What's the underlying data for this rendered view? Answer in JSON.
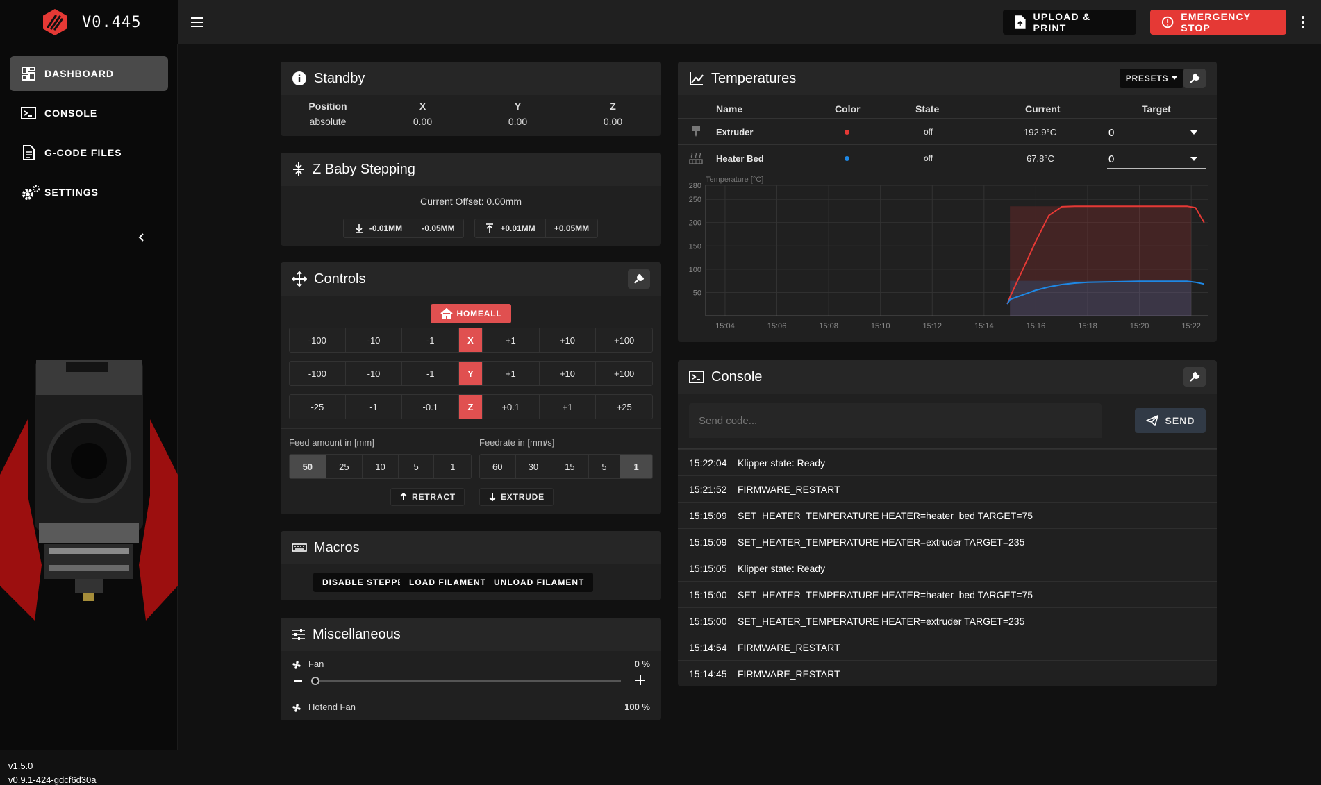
{
  "app": {
    "title": "V0.445"
  },
  "topbar": {
    "upload_label": "UPLOAD & PRINT",
    "estop_label": "EMERGENCY STOP"
  },
  "sidebar": {
    "items": [
      {
        "label": "DASHBOARD",
        "icon": "dashboard-icon",
        "active": true
      },
      {
        "label": "CONSOLE",
        "icon": "console-icon",
        "active": false
      },
      {
        "label": "G-CODE FILES",
        "icon": "file-icon",
        "active": false
      },
      {
        "label": "SETTINGS",
        "icon": "gear-icon",
        "active": false
      }
    ],
    "version_client": "v1.5.0",
    "version_klipper": "v0.9.1-424-gdcf6d30a"
  },
  "colors": {
    "accent": "#e53935",
    "axis": "#e05050",
    "extruder": "#e53935",
    "bed": "#1e88e5"
  },
  "standby": {
    "title": "Standby",
    "headers": [
      "Position",
      "X",
      "Y",
      "Z"
    ],
    "values": [
      "absolute",
      "0.00",
      "0.00",
      "0.00"
    ]
  },
  "babystep": {
    "title": "Z Baby Stepping",
    "offset_text": "Current Offset: 0.00mm",
    "down_buttons": [
      "-0.01MM",
      "-0.05MM"
    ],
    "up_buttons": [
      "+0.01MM",
      "+0.05MM"
    ]
  },
  "controls": {
    "title": "Controls",
    "home_label": "HOMEALL",
    "rows": [
      {
        "axis": "X",
        "minus": [
          "-100",
          "-10",
          "-1"
        ],
        "plus": [
          "+1",
          "+10",
          "+100"
        ]
      },
      {
        "axis": "Y",
        "minus": [
          "-100",
          "-10",
          "-1"
        ],
        "plus": [
          "+1",
          "+10",
          "+100"
        ]
      },
      {
        "axis": "Z",
        "minus": [
          "-25",
          "-1",
          "-0.1"
        ],
        "plus": [
          "+0.1",
          "+1",
          "+25"
        ]
      }
    ],
    "feed_label": "Feed amount in [mm]",
    "feed_values": [
      "50",
      "25",
      "10",
      "5",
      "1"
    ],
    "feed_selected": "50",
    "rate_label": "Feedrate in [mm/s]",
    "rate_values": [
      "60",
      "30",
      "15",
      "5",
      "1"
    ],
    "rate_selected": "1",
    "retract_label": "RETRACT",
    "extrude_label": "EXTRUDE"
  },
  "macros": {
    "title": "Macros",
    "buttons": [
      "DISABLE STEPPERS",
      "LOAD FILAMENT",
      "UNLOAD FILAMENT"
    ]
  },
  "misc": {
    "title": "Miscellaneous",
    "fan_label": "Fan",
    "fan_value": "0 %",
    "fan_level": 0,
    "hotend_label": "Hotend Fan",
    "hotend_value": "100 %"
  },
  "temps": {
    "title": "Temperatures",
    "presets_label": "PRESETS",
    "headers": {
      "name": "Name",
      "color": "Color",
      "state": "State",
      "current": "Current",
      "target": "Target"
    },
    "heaters": [
      {
        "name": "Extruder",
        "state": "off",
        "current": "192.9°C",
        "target": "0",
        "color": "#e53935"
      },
      {
        "name": "Heater Bed",
        "state": "off",
        "current": "67.8°C",
        "target": "0",
        "color": "#1e88e5"
      }
    ]
  },
  "chart_data": {
    "type": "line",
    "ylabel": "Temperature [°C]",
    "ylim": [
      0,
      280
    ],
    "yticks": [
      50,
      100,
      150,
      200,
      250,
      280
    ],
    "xticks": [
      "15:04",
      "15:06",
      "15:08",
      "15:10",
      "15:12",
      "15:14",
      "15:16",
      "15:18",
      "15:20",
      "15:22"
    ],
    "x": [
      "15:14:54",
      "15:15:00",
      "15:15:30",
      "15:16:00",
      "15:16:30",
      "15:17:00",
      "15:17:30",
      "15:18:00",
      "15:19:00",
      "15:20:00",
      "15:21:00",
      "15:21:50",
      "15:22:10",
      "15:22:30"
    ],
    "series": [
      {
        "name": "Extruder",
        "color": "#e53935",
        "values": [
          25,
          40,
          100,
          160,
          215,
          234,
          235,
          235,
          235,
          235,
          235,
          235,
          232,
          200
        ]
      },
      {
        "name": "Heater Bed",
        "color": "#1e88e5",
        "values": [
          25,
          35,
          45,
          55,
          62,
          67,
          70,
          72,
          73,
          74,
          74,
          74,
          72,
          68
        ]
      }
    ],
    "target_bands": [
      {
        "series": "Extruder",
        "from": "15:15:00",
        "to": "15:22:00",
        "value": 235
      },
      {
        "series": "Heater Bed",
        "from": "15:15:00",
        "to": "15:22:00",
        "value": 75
      }
    ],
    "grid": true
  },
  "console": {
    "title": "Console",
    "placeholder": "Send code...",
    "send_label": "SEND",
    "entries": [
      {
        "time": "15:22:04",
        "text": "Klipper state: Ready"
      },
      {
        "time": "15:21:52",
        "text": "FIRMWARE_RESTART"
      },
      {
        "time": "15:15:09",
        "text": "SET_HEATER_TEMPERATURE HEATER=heater_bed TARGET=75"
      },
      {
        "time": "15:15:09",
        "text": "SET_HEATER_TEMPERATURE HEATER=extruder TARGET=235"
      },
      {
        "time": "15:15:05",
        "text": "Klipper state: Ready"
      },
      {
        "time": "15:15:00",
        "text": "SET_HEATER_TEMPERATURE HEATER=heater_bed TARGET=75"
      },
      {
        "time": "15:15:00",
        "text": "SET_HEATER_TEMPERATURE HEATER=extruder TARGET=235"
      },
      {
        "time": "15:14:54",
        "text": "FIRMWARE_RESTART"
      },
      {
        "time": "15:14:45",
        "text": "FIRMWARE_RESTART"
      }
    ]
  }
}
